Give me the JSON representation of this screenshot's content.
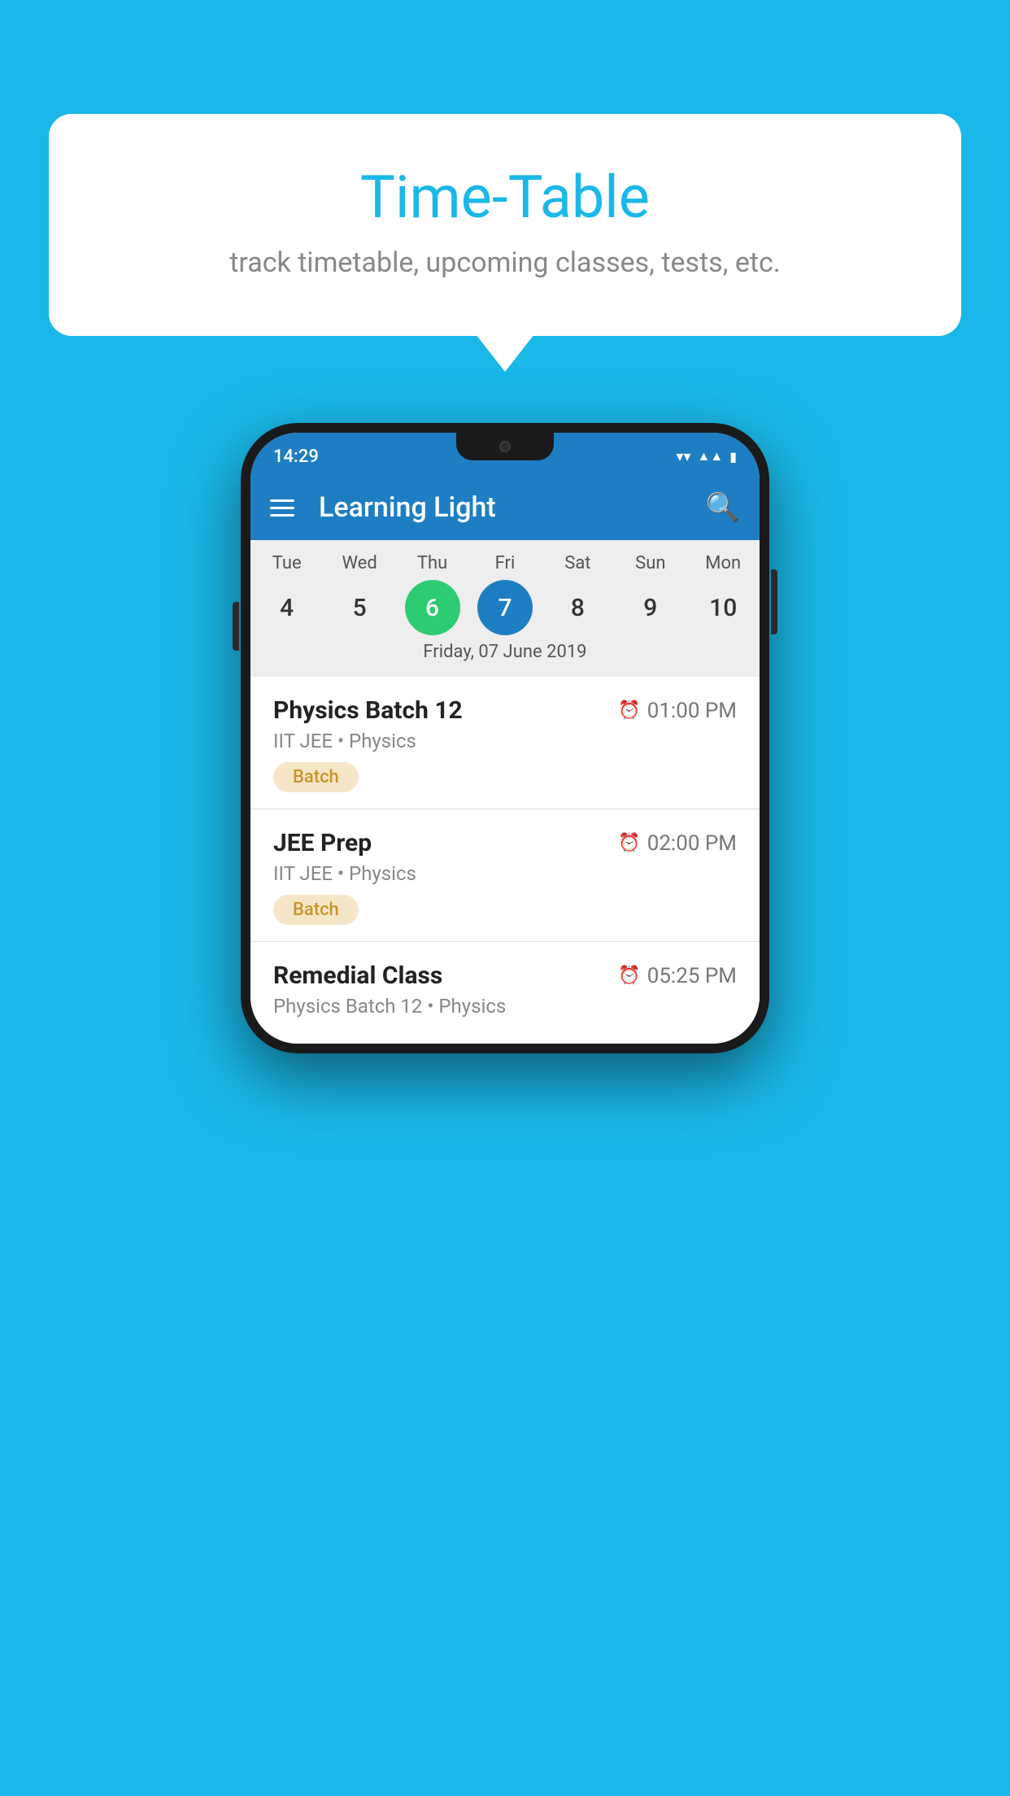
{
  "background_color": "#1ab8e8",
  "tooltip": {
    "title": "Time-Table",
    "subtitle": "track timetable, upcoming classes, tests, etc."
  },
  "phone": {
    "status_bar": {
      "time": "14:29"
    },
    "app_bar": {
      "title": "Learning Light"
    },
    "calendar": {
      "days": [
        {
          "name": "Tue",
          "num": "4",
          "state": "normal"
        },
        {
          "name": "Wed",
          "num": "5",
          "state": "normal"
        },
        {
          "name": "Thu",
          "num": "6",
          "state": "today"
        },
        {
          "name": "Fri",
          "num": "7",
          "state": "selected"
        },
        {
          "name": "Sat",
          "num": "8",
          "state": "normal"
        },
        {
          "name": "Sun",
          "num": "9",
          "state": "normal"
        },
        {
          "name": "Mon",
          "num": "10",
          "state": "normal"
        }
      ],
      "date_label": "Friday, 07 June 2019"
    },
    "schedule": [
      {
        "title": "Physics Batch 12",
        "time": "01:00 PM",
        "subtitle": "IIT JEE • Physics",
        "badge": "Batch"
      },
      {
        "title": "JEE Prep",
        "time": "02:00 PM",
        "subtitle": "IIT JEE • Physics",
        "badge": "Batch"
      },
      {
        "title": "Remedial Class",
        "time": "05:25 PM",
        "subtitle": "Physics Batch 12 • Physics",
        "badge": ""
      }
    ]
  }
}
